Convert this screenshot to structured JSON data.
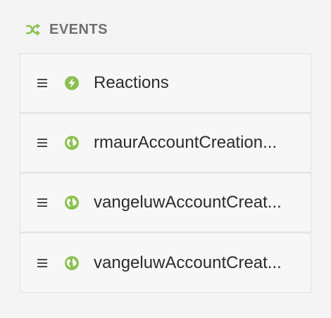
{
  "header": {
    "title": "EVENTS",
    "icon": "shuffle-icon",
    "icon_color": "#8cc152"
  },
  "colors": {
    "accent": "#8cc152",
    "text": "#2c2c2c",
    "header_text": "#6f6f6f"
  },
  "events": [
    {
      "label": "Reactions",
      "icon": "lightning-icon"
    },
    {
      "label": "rmaurAccountCreation...",
      "icon": "globe-icon"
    },
    {
      "label": "vangeluwAccountCreat...",
      "icon": "globe-icon"
    },
    {
      "label": "vangeluwAccountCreat...",
      "icon": "globe-icon"
    }
  ]
}
